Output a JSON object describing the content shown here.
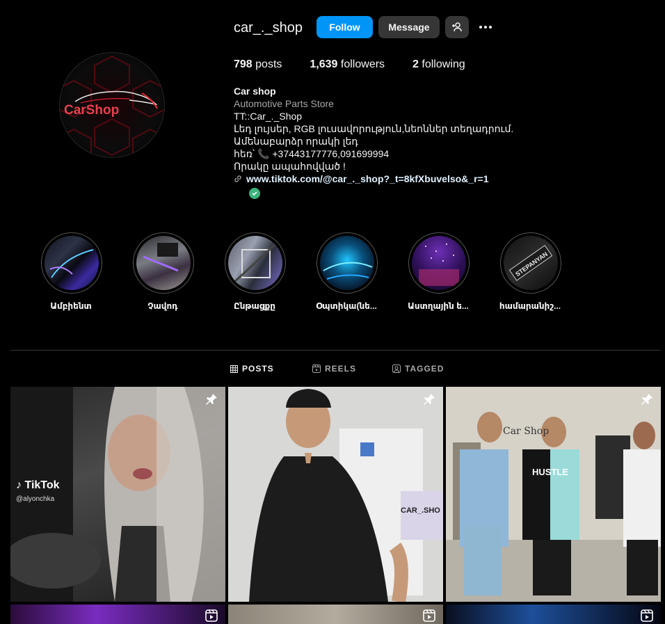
{
  "profile": {
    "username": "car_._shop",
    "follow_label": "Follow",
    "message_label": "Message",
    "posts_count": "798",
    "posts_label": "posts",
    "followers_count": "1,639",
    "followers_label": "followers",
    "following_count": "2",
    "following_label": "following",
    "avatar_text": "CarShop"
  },
  "bio": {
    "name": "Car shop",
    "category": "Automotive Parts Store",
    "lines": [
      "TT::Car_._Shop",
      "Լեդ լույսեր, RGB լուսավորություն,նեոններ տեղադրում.",
      "Ամենաբարձր որակի լեդ",
      "հեռ՝ 📞 +37443177776,091699994",
      "Որակը ապահովված !"
    ],
    "link": "www.tiktok.com/@car_._shop?_t=8kfXbuvelso&_r=1"
  },
  "highlights": [
    {
      "label": "Ամբիենտ"
    },
    {
      "label": "Չավոդ"
    },
    {
      "label": "Ընթացքը"
    },
    {
      "label": "Օպտիկա(նե..."
    },
    {
      "label": "Աստղային ե..."
    },
    {
      "label": "համարանիշ..."
    }
  ],
  "highlight_overlays": {
    "plate_text": "STEPANYAN"
  },
  "tabs": [
    {
      "label": "POSTS",
      "icon": "grid-icon",
      "active": true
    },
    {
      "label": "REELS",
      "icon": "reels-icon",
      "active": false
    },
    {
      "label": "TAGGED",
      "icon": "tagged-icon",
      "active": false
    }
  ],
  "posts": {
    "tiktok_brand": "TikTok",
    "tiktok_handle": "@alyonchka",
    "post2_sign": "CAR_.SHO",
    "post3_wall": "Car Shop",
    "post3_shirt": "HUSTLE"
  },
  "colors": {
    "accent": "#0095f6",
    "background": "#000000",
    "button_secondary": "#363636",
    "link": "#e0f1ff",
    "verified": "#3bb47b"
  }
}
